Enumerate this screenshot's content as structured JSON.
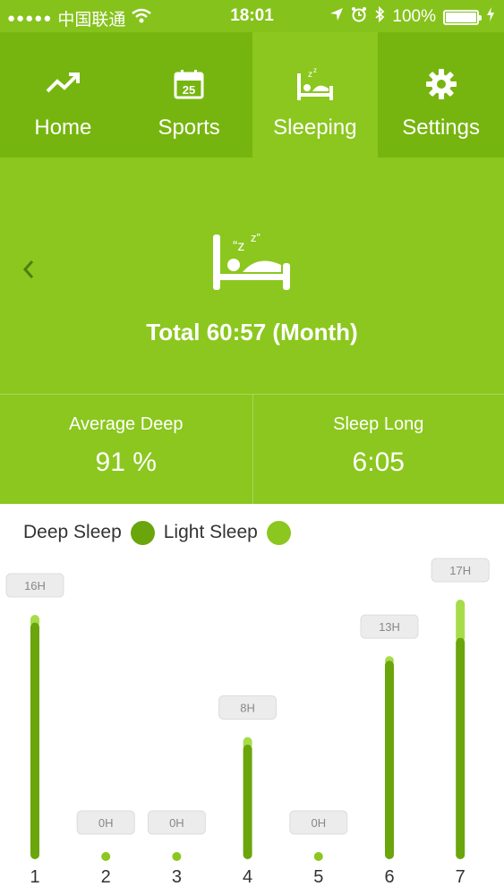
{
  "status_bar": {
    "carrier": "中国联通",
    "signal_dots": "●●●●●",
    "time": "18:01",
    "battery": "100%",
    "icons": [
      "wifi-icon",
      "location-arrow-icon",
      "alarm-icon",
      "bluetooth-icon",
      "battery-icon",
      "charging-icon"
    ]
  },
  "tabs": [
    {
      "label": "Home",
      "icon": "trend-up-icon"
    },
    {
      "label": "Sports",
      "icon": "calendar-icon",
      "icon_text": "25"
    },
    {
      "label": "Sleeping",
      "icon": "bed-icon",
      "active": true
    },
    {
      "label": "Settings",
      "icon": "gear-icon"
    }
  ],
  "hero": {
    "icon": "sleeping-bed-icon",
    "total": "Total 60:57 (Month)"
  },
  "stats": {
    "average_deep_label": "Average Deep",
    "average_deep_value": "91 %",
    "sleep_long_label": "Sleep Long",
    "sleep_long_value": "6:05"
  },
  "legend": {
    "deep_label": "Deep Sleep",
    "light_label": "Light Sleep"
  },
  "colors": {
    "primary": "#8bc71e",
    "tab_inactive": "#76b50f",
    "deep": "#6aa50c",
    "light": "#a6dc4a"
  },
  "chart_data": {
    "type": "bar",
    "categories": [
      "1",
      "2",
      "3",
      "4",
      "5",
      "6",
      "7"
    ],
    "series": [
      {
        "name": "Deep Sleep",
        "values": [
          15.5,
          0,
          0,
          7.5,
          0,
          13,
          14.5
        ]
      },
      {
        "name": "Light Sleep",
        "values": [
          0.5,
          0,
          0,
          0.5,
          0,
          0.3,
          2.5
        ]
      }
    ],
    "data_labels": [
      "16H",
      "0H",
      "0H",
      "8H",
      "0H",
      "13H",
      "17H"
    ],
    "ylim": [
      0,
      17
    ]
  }
}
